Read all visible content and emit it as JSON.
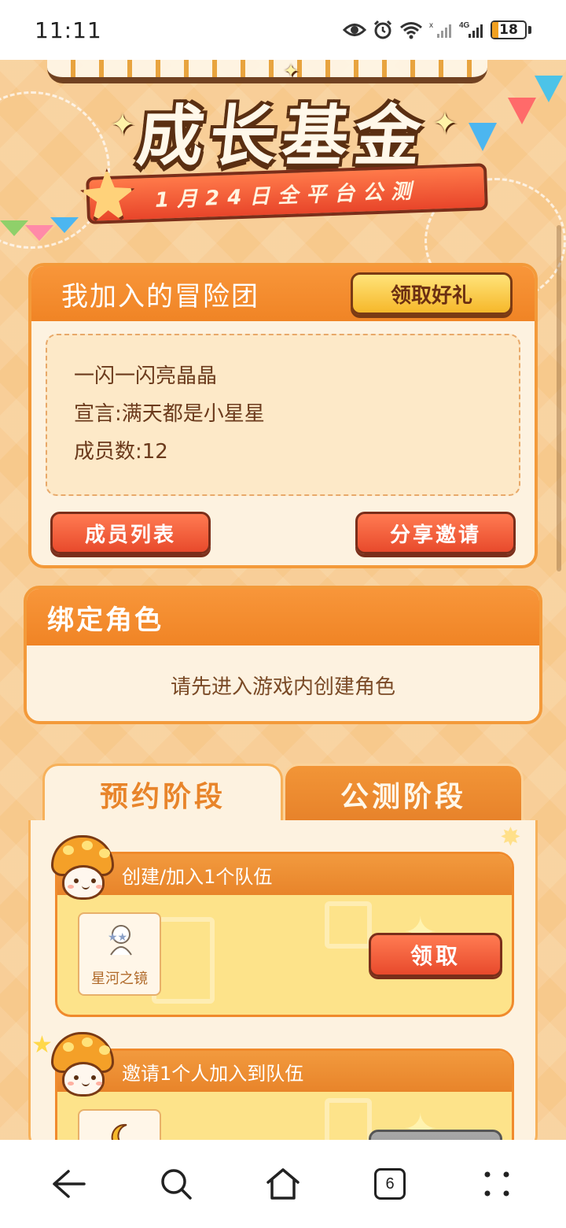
{
  "status_bar": {
    "time": "11:11",
    "network": "4G",
    "battery": "18"
  },
  "banner": {
    "title": "成长基金",
    "subtitle": "1月24日全平台公测"
  },
  "team_card": {
    "title": "我加入的冒险团",
    "gift_button": "领取好礼",
    "team_name": "一闪一闪亮晶晶",
    "declaration": "宣言:满天都是小星星",
    "member_count": "成员数:12",
    "member_list_button": "成员列表",
    "share_button": "分享邀请"
  },
  "bind_card": {
    "title": "绑定角色",
    "message": "请先进入游戏内创建角色"
  },
  "tabs": [
    {
      "label": "预约阶段",
      "active": true
    },
    {
      "label": "公测阶段",
      "active": false
    }
  ],
  "tasks": [
    {
      "title": "创建/加入1个队伍",
      "reward_name": "星河之镜",
      "claim_label": "领取"
    },
    {
      "title": "邀请1个人加入到队伍",
      "reward_name": "",
      "claim_label": ""
    }
  ],
  "bottom_nav": {
    "tab_count": "6"
  },
  "colors": {
    "accent_orange": "#f08425",
    "button_red": "#e84a2c",
    "button_yellow": "#f6b82a",
    "card_bg": "#fdf2e0"
  }
}
